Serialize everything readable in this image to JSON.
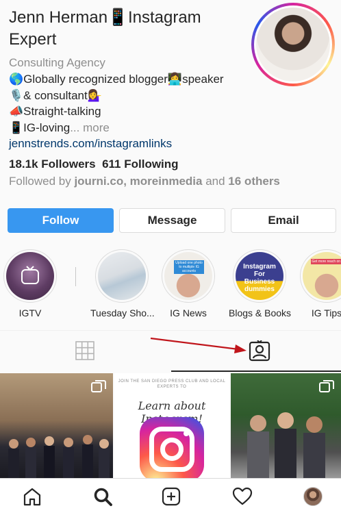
{
  "profile": {
    "name": "Jenn Herman📱Instagram Expert",
    "category": "Consulting Agency",
    "bio_lines": [
      "🌎Globally recognized blogger👩‍💻speaker",
      "🎙️& consultant💁‍♀️",
      "📣Straight-talking",
      "📱IG-loving"
    ],
    "bio_more": "... more",
    "link": "jennstrends.com/instagramlinks",
    "followers": "18.1k Followers",
    "following": "611 Following",
    "followed_by_prefix": "Followed by ",
    "followed_by_names": "journi.co, moreinmedia",
    "followed_by_and": " and ",
    "followed_by_others": "16 others"
  },
  "actions": {
    "follow_label": "Follow",
    "message_label": "Message",
    "email_label": "Email"
  },
  "highlights": [
    {
      "label": "IGTV"
    },
    {
      "label": "Tuesday Sho..."
    },
    {
      "label": "IG News",
      "thumb_text": "Upload one photo to multiple IG accounts"
    },
    {
      "label": "Blogs & Books",
      "thumb_text": "Instagram For Business dummies"
    },
    {
      "label": "IG Tips",
      "thumb_text": "Get more reach on IG w..."
    }
  ],
  "posts": {
    "post2_small": "JOIN THE SAN DIEGO PRESS CLUB AND LOCAL EXPERTS TO",
    "post2_script": "Learn about Instagram!"
  },
  "icons": {
    "grid_tab": "grid-icon",
    "tagged_tab": "tagged-user-icon",
    "home": "home-icon",
    "search": "search-icon",
    "add": "add-post-icon",
    "activity": "heart-icon",
    "profile": "profile-avatar-icon"
  },
  "colors": {
    "accent": "#3897f0",
    "annotation_arrow": "#c0151b",
    "link": "#00376b",
    "muted": "#8e8e8e"
  }
}
